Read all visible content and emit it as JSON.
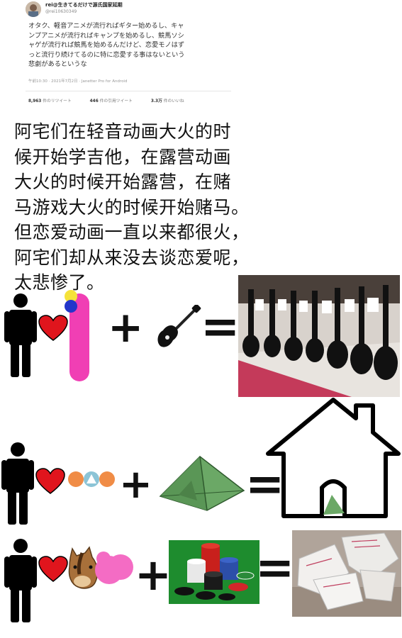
{
  "tweet": {
    "name": "rei@生きてるだけで源氏国家延期",
    "handle": "@rei10630349",
    "lines": [
      "オタク、軽音アニメが流行ればギター始めるし、キャ",
      "ンプアニメが流行ればキャンプを始めるし、競馬ソシ",
      "ャゲが流行れば競馬を始めるんだけど、恋愛モノはず",
      "っと流行り続けてるのに特に恋愛する事はないという",
      "悲劇があるというな"
    ],
    "meta": "午前10:30 · 2021年7月2日 · Janetter Pro for Android",
    "retweets": "8,963",
    "retweets_label": "件のリツイート",
    "quotes": "446",
    "quotes_label": "件の引用ツイート",
    "likes": "3.3万",
    "likes_label": "件のいいね"
  },
  "caption_lines": [
    "阿宅们在轻音动画大火的时",
    "候开始学吉他，在露营动画",
    "大火的时候开始露营，在赌",
    "马游戏大火的时候开始赌马。",
    "但恋爱动画一直以来都很火，",
    "阿宅们却从来没去谈恋爱呢，",
    "太悲惨了。"
  ],
  "operators": {
    "plus": "+",
    "equals": "="
  },
  "colors": {
    "pink_bar": "#f03fb4",
    "heart": "#e0151d",
    "orange_circle": "#f08c46",
    "teal_circle": "#8cc4d6",
    "tent": "#6ba866",
    "poker_bg": "#1e8c2e",
    "horse": "#a8703a"
  },
  "icons": {
    "person": "person-icon",
    "heart": "heart-icon",
    "guitar": "guitar-icon",
    "tent": "tent-icon",
    "house": "house-icon",
    "horse": "horse-icon"
  }
}
